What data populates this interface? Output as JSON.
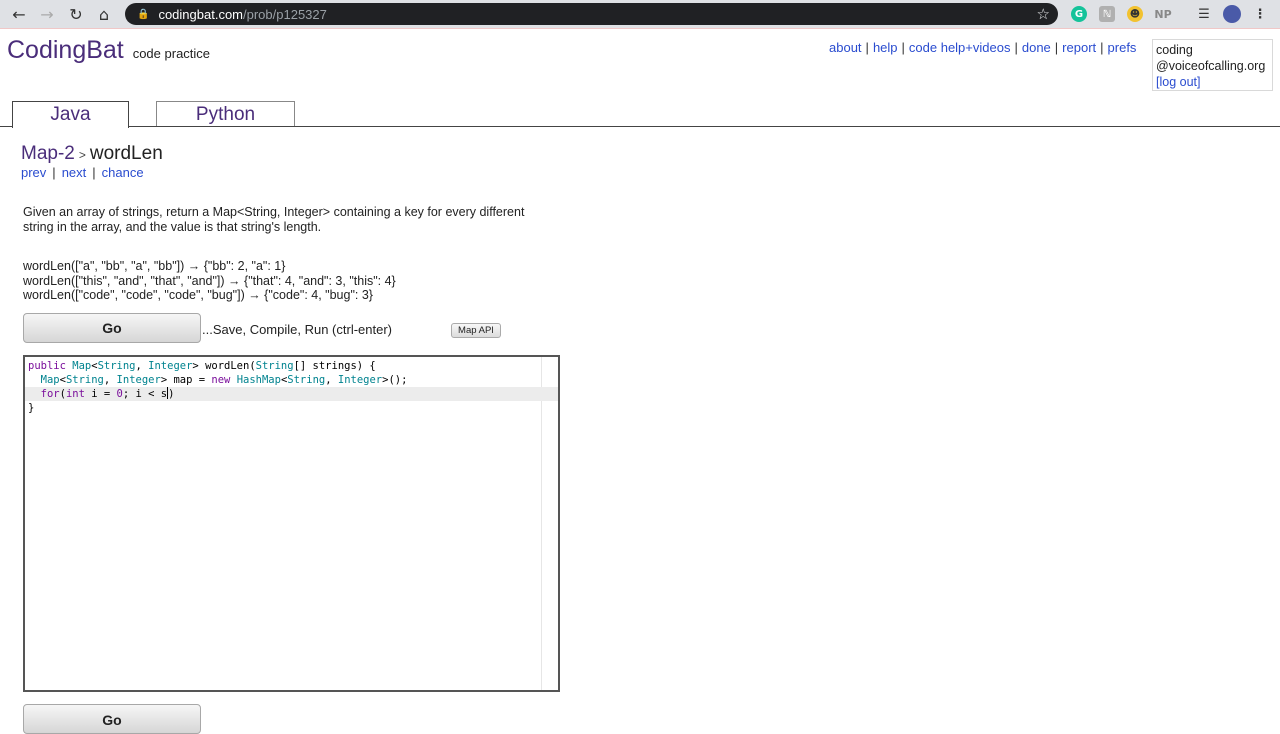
{
  "browser": {
    "url_host": "codingbat.com",
    "url_path": "/prob/p125327",
    "extensions": [
      "G",
      "NP"
    ]
  },
  "site": {
    "logo": "CodingBat",
    "tagline": "code practice",
    "links": [
      "about",
      "help",
      "code help+videos",
      "done",
      "report",
      "prefs"
    ],
    "user": {
      "line1": "coding",
      "line2": "@voiceofcalling.org",
      "logout": "[log out]"
    }
  },
  "tabs": [
    {
      "label": "Java",
      "active": true
    },
    {
      "label": "Python",
      "active": false
    }
  ],
  "problem": {
    "category": "Map-2",
    "separator": ">",
    "name": "wordLen",
    "nav": [
      "prev",
      "next",
      "chance"
    ],
    "description": "Given an array of strings, return a Map<String, Integer> containing a key for every different string in the array, and the value is that string's length.",
    "examples": [
      "wordLen([\"a\", \"bb\", \"a\", \"bb\"]) → {\"bb\": 2, \"a\": 1}",
      "wordLen([\"this\", \"and\", \"that\", \"and\"]) → {\"that\": 4, \"and\": 3, \"this\": 4}",
      "wordLen([\"code\", \"code\", \"code\", \"bug\"]) → {\"code\": 4, \"bug\": 3}"
    ]
  },
  "controls": {
    "go_label": "Go",
    "save_hint": "...Save, Compile, Run (ctrl-enter)",
    "map_api_label": "Map API"
  },
  "editor": {
    "lines": [
      "public Map<String, Integer> wordLen(String[] strings) {",
      "  Map<String, Integer> map = new HashMap<String, Integer>();",
      "  for(int i = 0; i < s)",
      "}"
    ],
    "active_line": 3
  },
  "colors": {
    "brand": "#4a2d7a",
    "link": "#2a4ccf"
  }
}
